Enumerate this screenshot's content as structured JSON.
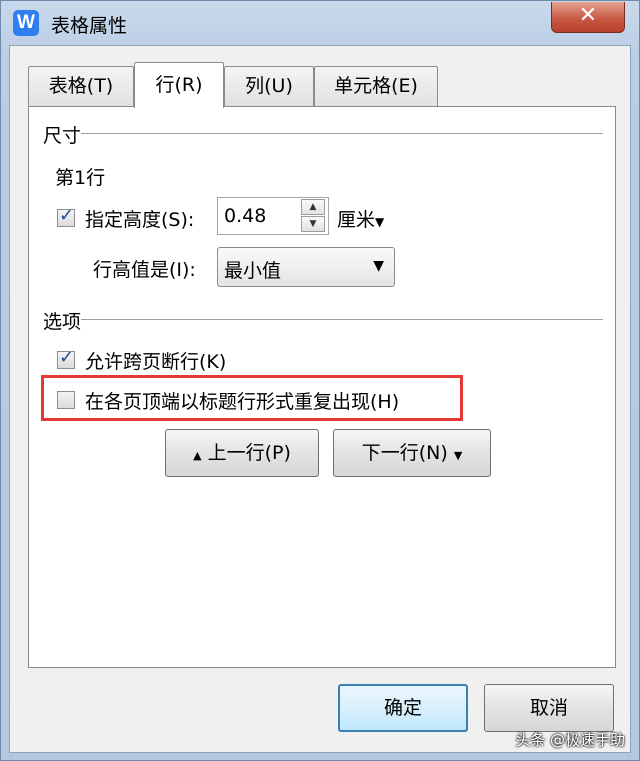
{
  "window": {
    "title": "表格属性",
    "app_icon_letter": "W",
    "close_symbol": "✕"
  },
  "tabs": [
    {
      "label": "表格(T)"
    },
    {
      "label": "行(R)"
    },
    {
      "label": "列(U)"
    },
    {
      "label": "单元格(E)"
    }
  ],
  "size_section": {
    "label": "尺寸",
    "row_label": "第1行",
    "specify_height_label": "指定高度(S):",
    "specify_height_checked": true,
    "height_value": "0.48",
    "unit_label": "厘米",
    "row_height_is_label": "行高值是(I):",
    "row_height_mode": "最小值"
  },
  "options_section": {
    "label": "选项",
    "allow_break_label": "允许跨页断行(K)",
    "allow_break_checked": true,
    "repeat_header_label": "在各页顶端以标题行形式重复出现(H)",
    "repeat_header_checked": false
  },
  "nav": {
    "prev_label": "上一行(P)",
    "next_label": "下一行(N)"
  },
  "footer": {
    "ok_label": "确定",
    "cancel_label": "取消"
  },
  "watermark": "头条 @极速手助",
  "colors": {
    "highlight": "#e53935",
    "checkmark": "#1f4e9a",
    "app_icon": "#2f7ff0"
  }
}
